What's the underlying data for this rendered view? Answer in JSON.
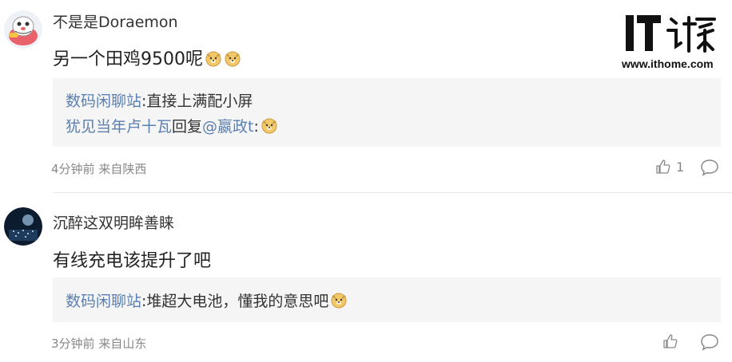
{
  "site": {
    "url": "www.ithome.com"
  },
  "comments": [
    {
      "user": "不是是Doraemon",
      "text": "另一个田鸡9500呢",
      "quotes": [
        {
          "name": "数码闲聊站",
          "sep": ":",
          "text": "直接上满配小屏"
        },
        {
          "name": "犹见当年卢十瓦",
          "mid": "回复",
          "target": "@嬴政t",
          "sep": ":"
        }
      ],
      "time": "4分钟前",
      "location": "来自陕西",
      "likes": "1"
    },
    {
      "user": "沉醉这双明眸善睐",
      "text": "有线充电该提升了吧",
      "quotes": [
        {
          "name": "数码闲聊站",
          "sep": ":",
          "text": "堆超大电池，懂我的意思吧"
        }
      ],
      "time": "3分钟前",
      "location": "来自山东",
      "likes": ""
    }
  ],
  "icons": {
    "like": "thumbs-up-icon",
    "reply": "speech-bubble-icon",
    "emoji": "doge-emoji-icon"
  }
}
